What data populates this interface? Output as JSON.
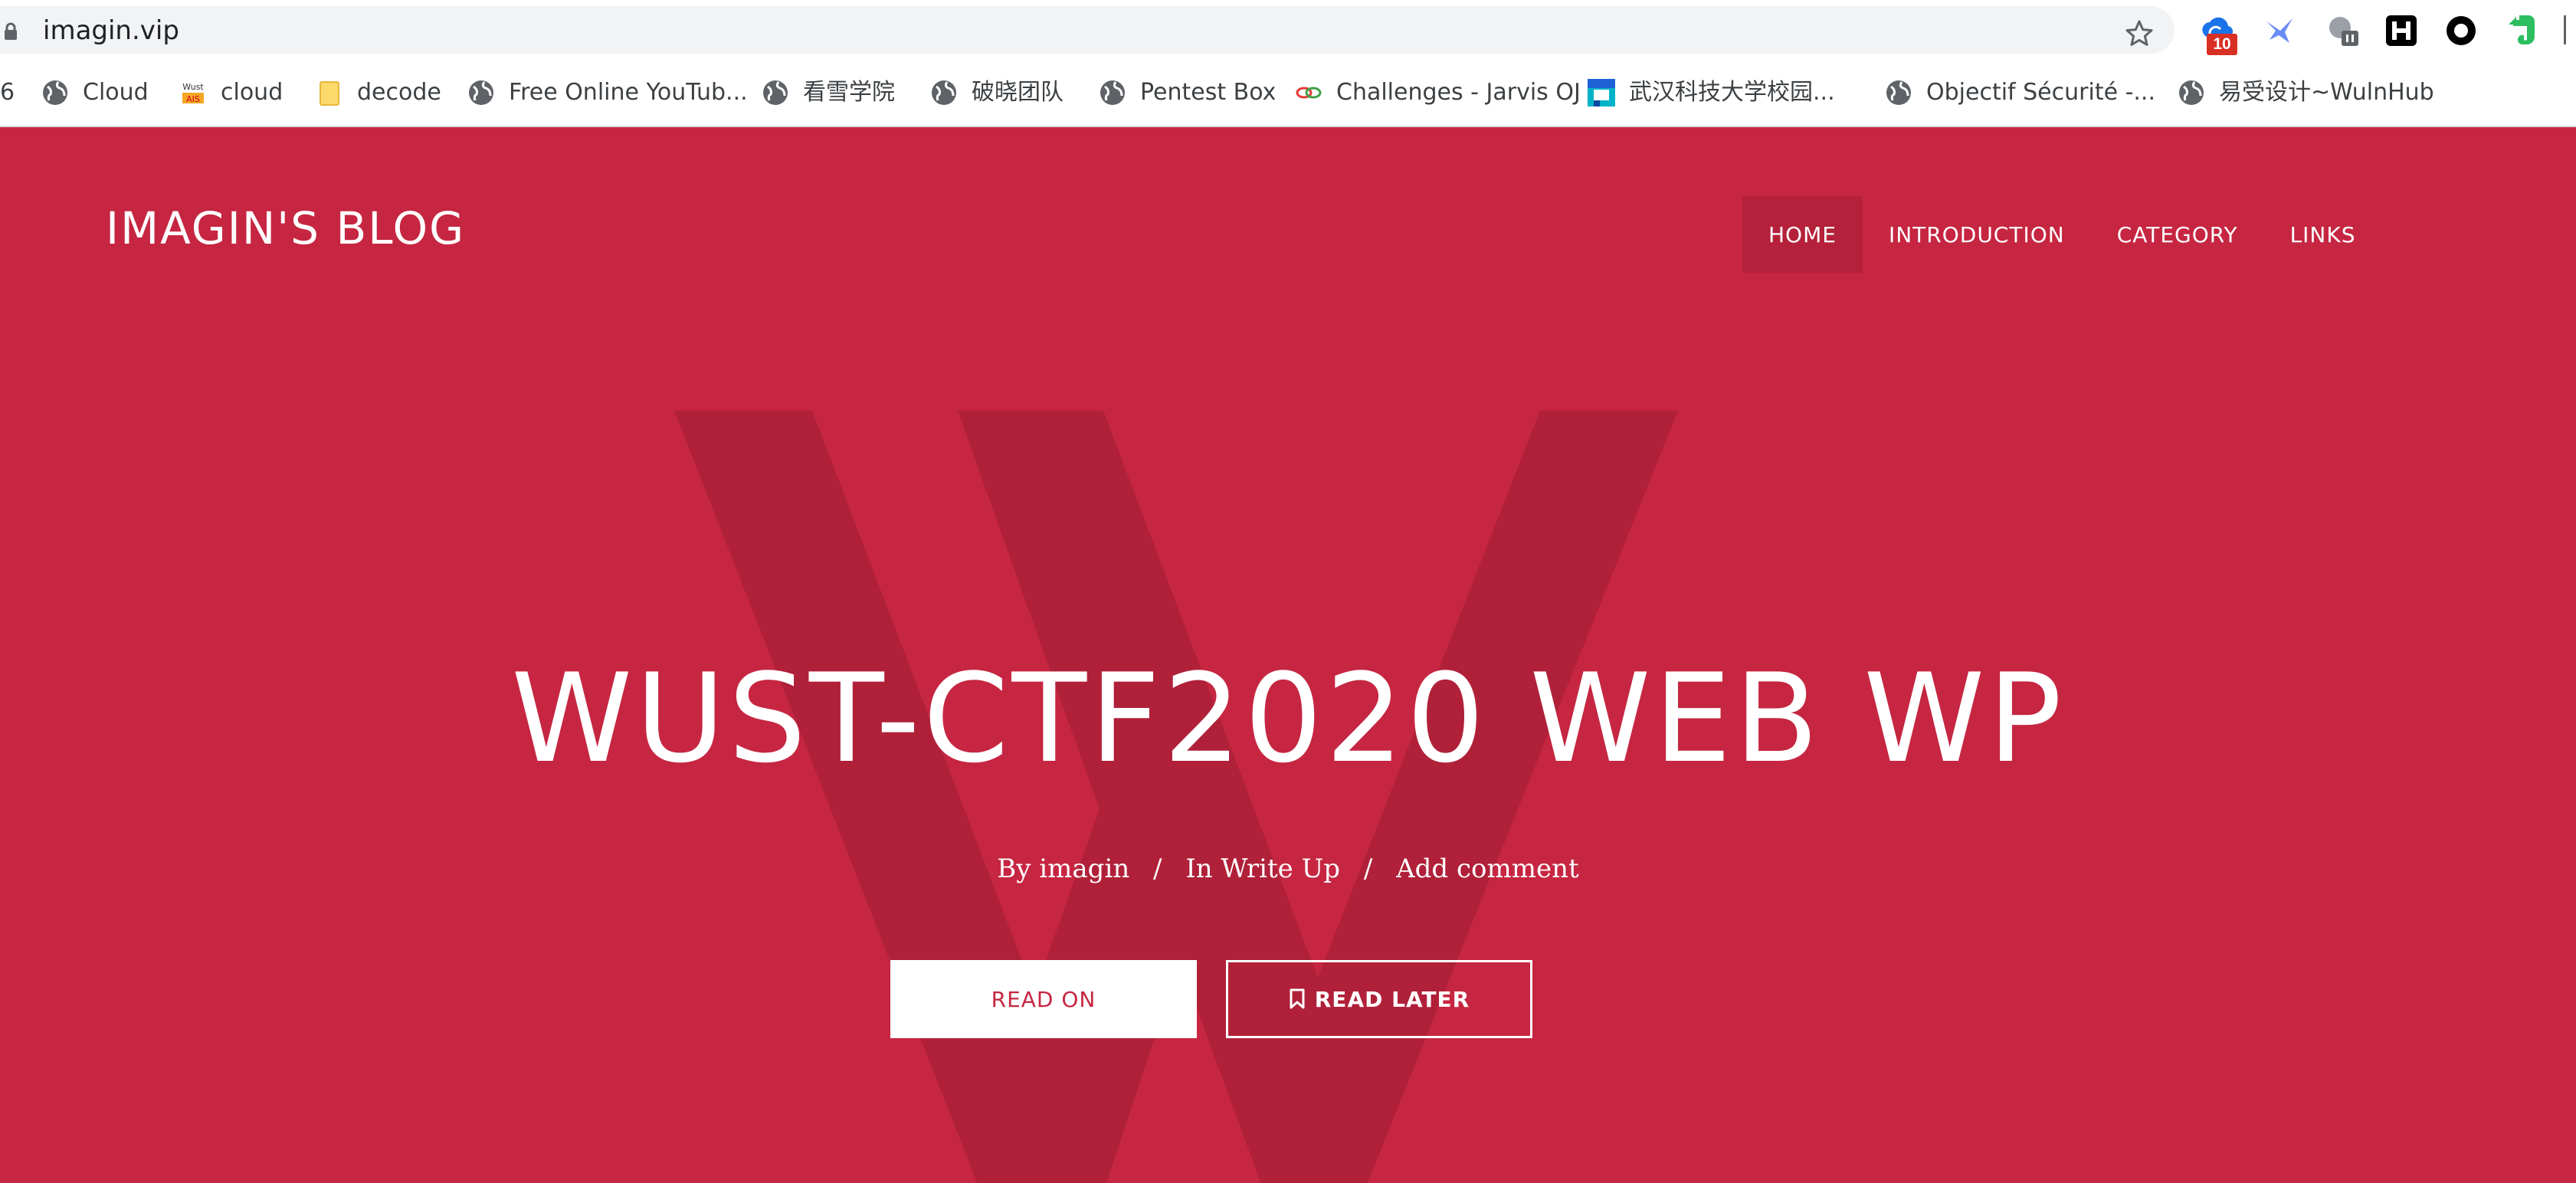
{
  "browser": {
    "url": "imagin.vip",
    "extensions": [
      {
        "icon": "cloud-sync-icon",
        "badge": "10"
      },
      {
        "icon": "swallow-icon"
      },
      {
        "icon": "globe-paused-icon"
      },
      {
        "icon": "h-logo-icon"
      },
      {
        "icon": "ring-icon"
      },
      {
        "icon": "evernote-elephant-icon"
      }
    ]
  },
  "bookmarks": [
    {
      "label": "6",
      "icon": ""
    },
    {
      "label": "Cloud",
      "icon": "globe-icon"
    },
    {
      "label": "cloud",
      "icon": "wust-ais-icon"
    },
    {
      "label": "decode",
      "icon": "folder-icon"
    },
    {
      "label": "Free Online YouTub...",
      "icon": "globe-icon"
    },
    {
      "label": "看雪学院",
      "icon": "globe-icon"
    },
    {
      "label": "破晓团队",
      "icon": "globe-icon"
    },
    {
      "label": "Pentest Box",
      "icon": "globe-icon"
    },
    {
      "label": "Challenges - Jarvis OJ",
      "icon": "chain-link-icon"
    },
    {
      "label": "武汉科技大学校园...",
      "icon": "campus-logo-icon"
    },
    {
      "label": "Objectif Sécurité -...",
      "icon": "globe-icon"
    },
    {
      "label": "易受设计~WulnHub",
      "icon": "globe-icon"
    }
  ],
  "site": {
    "title": "IMAGIN'S BLOG",
    "nav": [
      {
        "label": "HOME",
        "active": true
      },
      {
        "label": "INTRODUCTION",
        "active": false
      },
      {
        "label": "CATEGORY",
        "active": false
      },
      {
        "label": "LINKS",
        "active": false
      }
    ]
  },
  "post": {
    "title": "WUST-CTF2020 WEB WP",
    "author": "By imagin",
    "category": "In Write Up",
    "comment": "Add comment",
    "separator": "/",
    "read_on": "READ ON",
    "read_later": "READ LATER",
    "watermark_letter": "W"
  },
  "colors": {
    "hero_bg": "#c62641",
    "active_nav_bg": "#b5213a",
    "watermark": "#b02039"
  }
}
